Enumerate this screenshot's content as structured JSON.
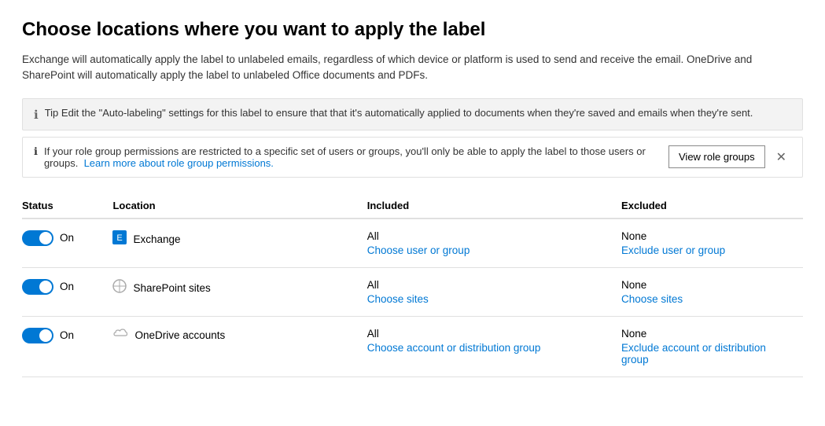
{
  "header": {
    "title": "Choose locations where you want to apply the label",
    "description": "Exchange will automatically apply the label to unlabeled emails, regardless of which device or platform is used to send and receive the email. OneDrive and SharePoint will automatically apply the label to unlabeled Office documents and PDFs."
  },
  "tip": {
    "text": "Tip Edit the \"Auto-labeling\" settings for this label to ensure that that it's automatically applied to documents when they're saved and emails when they're sent."
  },
  "role_notice": {
    "text": "If your role group permissions are restricted to a specific set of users or groups, you'll only be able to apply the label to those users or groups.",
    "link_text": "Learn more about role group permissions.",
    "button_label": "View role groups"
  },
  "table": {
    "columns": [
      "Status",
      "Location",
      "Included",
      "Excluded"
    ],
    "rows": [
      {
        "status": "On",
        "location": "Exchange",
        "location_icon": "exchange",
        "included_main": "All",
        "included_link": "Choose user or group",
        "excluded_main": "None",
        "excluded_link": "Exclude user or group"
      },
      {
        "status": "On",
        "location": "SharePoint sites",
        "location_icon": "sharepoint",
        "included_main": "All",
        "included_link": "Choose sites",
        "excluded_main": "None",
        "excluded_link": "Choose sites"
      },
      {
        "status": "On",
        "location": "OneDrive accounts",
        "location_icon": "onedrive",
        "included_main": "All",
        "included_link": "Choose account or distribution group",
        "excluded_main": "None",
        "excluded_link": "Exclude account or distribution group"
      }
    ]
  }
}
